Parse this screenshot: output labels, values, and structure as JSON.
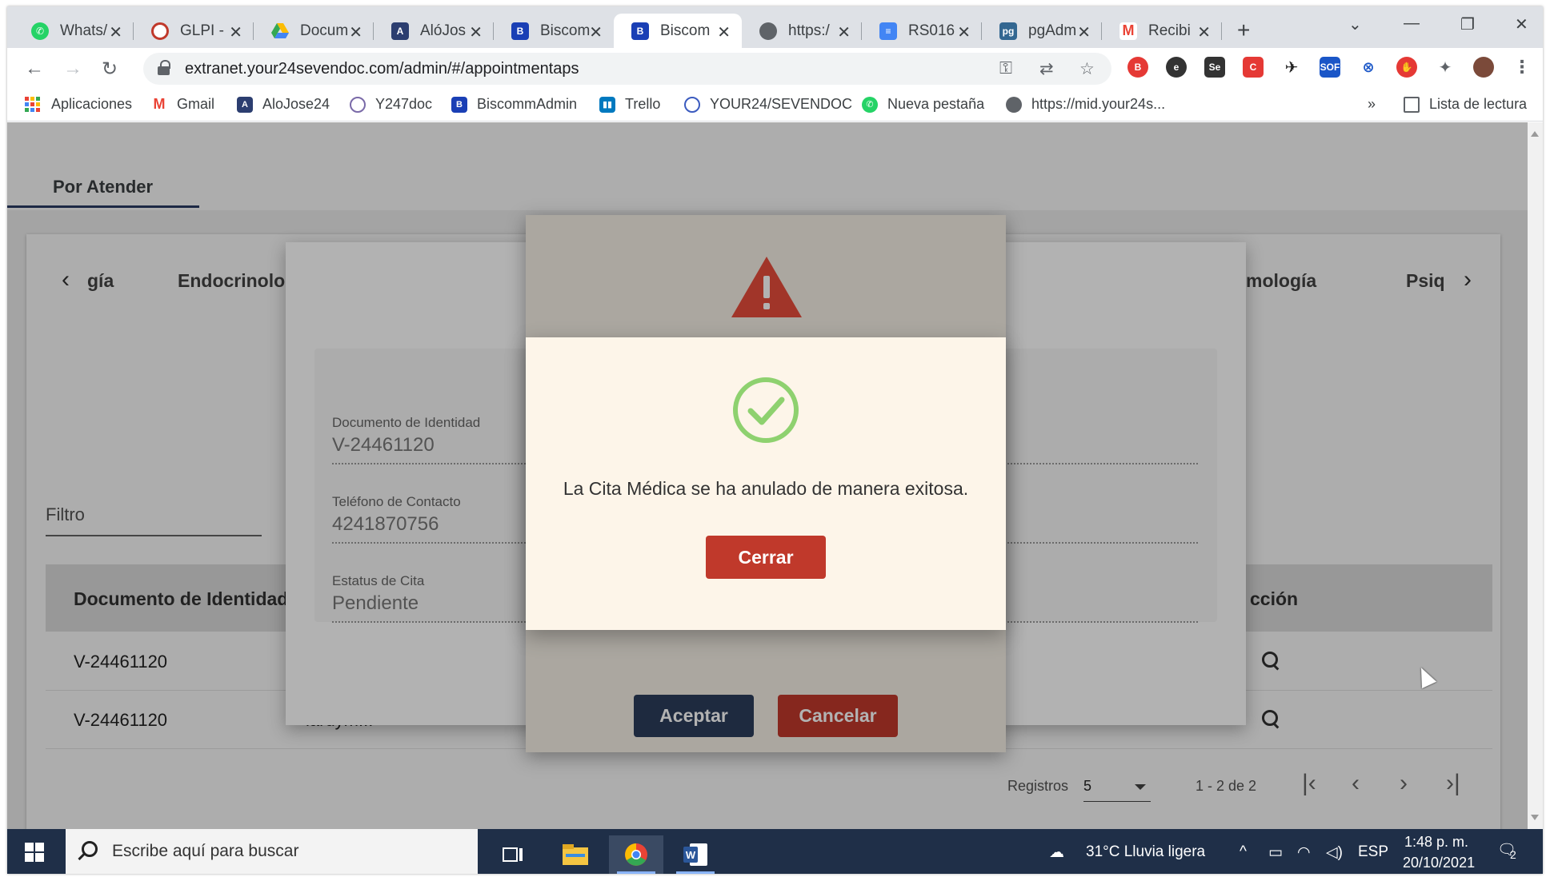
{
  "browser": {
    "tabs": [
      {
        "title": "Whats/",
        "icon": "whatsapp-icon",
        "color": "#25d366"
      },
      {
        "title": "GLPI -",
        "icon": "glpi-icon",
        "color": "#c0392b"
      },
      {
        "title": "Docum",
        "icon": "google-drive-icon",
        "color": "#fbbc04"
      },
      {
        "title": "AlóJos",
        "icon": "alojose-icon",
        "color": "#2c3e70"
      },
      {
        "title": "Biscom",
        "icon": "biscomm-icon",
        "color": "#1a3fb5"
      },
      {
        "title": "Biscom",
        "icon": "biscomm-icon",
        "color": "#1a3fb5",
        "active": true
      },
      {
        "title": "https:/",
        "icon": "globe-icon",
        "color": "#5f6368"
      },
      {
        "title": "RS016",
        "icon": "google-docs-icon",
        "color": "#4285f4"
      },
      {
        "title": "pgAdm",
        "icon": "pgadmin-icon",
        "color": "#336791"
      },
      {
        "title": "Recibi",
        "icon": "gmail-icon",
        "color": "#ea4335"
      }
    ],
    "address": {
      "url": "extranet.your24sevendoc.com/admin/#/appointmentaps"
    },
    "bookmarks": [
      {
        "label": "Aplicaciones",
        "icon": "apps-grid-icon"
      },
      {
        "label": "Gmail",
        "icon": "gmail-icon"
      },
      {
        "label": "AloJose24",
        "icon": "alojose-icon"
      },
      {
        "label": "Y247doc",
        "icon": "y247doc-icon"
      },
      {
        "label": "BiscommAdmin",
        "icon": "biscomm-icon"
      },
      {
        "label": "Trello",
        "icon": "trello-icon"
      },
      {
        "label": "YOUR24/SEVENDOC",
        "icon": "your24-icon"
      },
      {
        "label": "Nueva pestaña",
        "icon": "whatsapp-icon"
      },
      {
        "label": "https://mid.your24s...",
        "icon": "globe-icon"
      }
    ],
    "bookmarks_overflow": "»",
    "reading_list": "Lista de lectura"
  },
  "page": {
    "tab_label": "Por Atender",
    "specialties": [
      "gía",
      "Endocrinolog",
      "mología",
      "Psiq"
    ],
    "filter_label": "Filtro",
    "table": {
      "headers": [
        "Documento de Identidad",
        "cción"
      ],
      "rows": [
        {
          "doc": "V-24461120"
        },
        {
          "doc": "V-24461120",
          "name": "laruym..."
        }
      ]
    },
    "pager": {
      "label": "Registros",
      "page_size": "5",
      "range": "1 - 2 de 2"
    }
  },
  "detail_dialog": {
    "fields": [
      {
        "label": "Documento de Identidad",
        "value": "V-24461120"
      },
      {
        "label": "Teléfono de Contacto",
        "value": "4241870756"
      },
      {
        "label": "Estatus de Cita",
        "value": "Pendiente"
      }
    ]
  },
  "confirm_dialog": {
    "accept_label": "Aceptar",
    "cancel_label": "Cancelar",
    "accept_color": "#2b3d5b",
    "cancel_color": "#c0392b"
  },
  "success_dialog": {
    "message": "La Cita Médica se ha anulado de manera exitosa.",
    "close_label": "Cerrar",
    "check_color": "#8ed16f",
    "button_color": "#c0392b"
  },
  "taskbar": {
    "search_placeholder": "Escribe aquí para buscar",
    "weather": "31°C  Lluvia ligera",
    "language": "ESP",
    "time": "1:48 p. m.",
    "date": "20/10/2021",
    "notifications": "2"
  }
}
